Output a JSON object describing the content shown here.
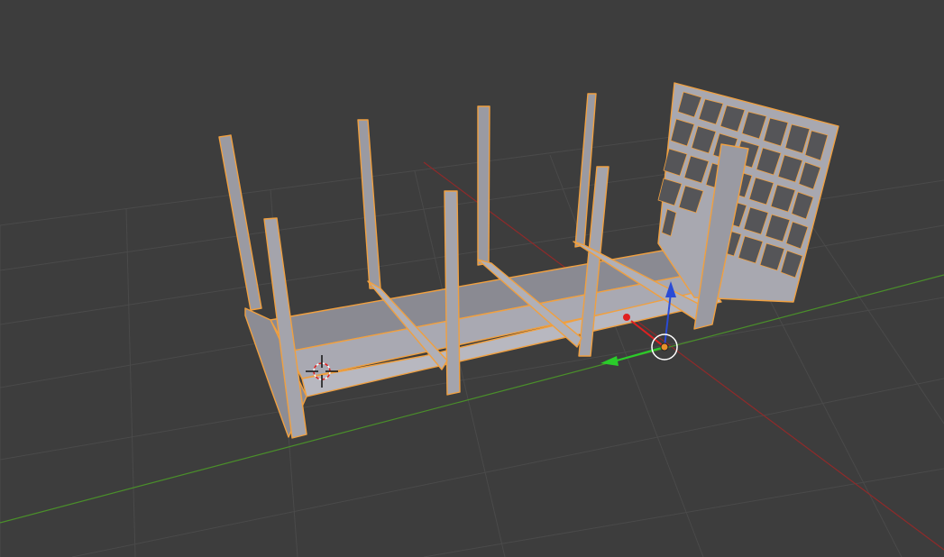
{
  "viewport": {
    "background": "#3d3d3d",
    "grid_color": "#4a4a4a",
    "x_axis_color": "#8f2a2a",
    "y_axis_color": "#4a8f2a",
    "selection_outline_color": "#f0a040",
    "mesh_face_light": "#b4b4bc",
    "mesh_face_mid": "#9c9ca4",
    "mesh_face_dark": "#76767e",
    "gizmo_z_color": "#2a4bd6",
    "gizmo_y_color": "#2acc2a",
    "gizmo_x_color": "#e02020",
    "origin_color": "#e8902a"
  },
  "icons": {
    "cursor": "3d-cursor-icon",
    "transform_gizmo": "transform-gizmo-icon",
    "object_origin": "object-origin-icon"
  }
}
